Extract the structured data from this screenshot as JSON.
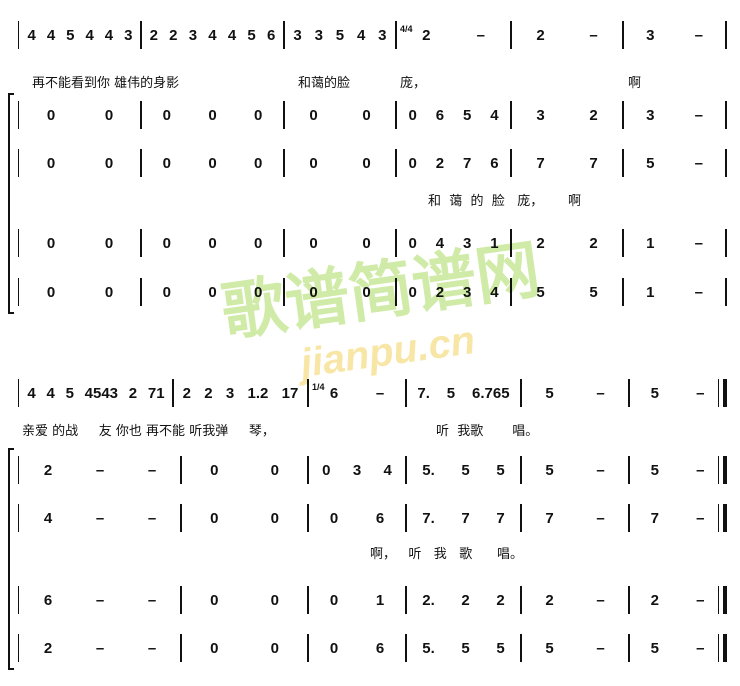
{
  "watermark": {
    "main": "歌谱简谱网",
    "sub": "jianpu.cn",
    "color": "#96d23c"
  },
  "systems": [
    {
      "time_signature": "4/4",
      "melody": [
        "4 4 5 4 4 3",
        "2 2 3 4 4 5 6",
        "3 3 5 4 3",
        "2 –",
        "2 –",
        "3 –"
      ],
      "melody_lyrics": [
        "再不能看到你 雄伟的身影",
        "和蔼的脸",
        "庞，",
        "啊"
      ],
      "parts": [
        [
          "0 0",
          "0 0 0",
          "0 0",
          "0 6 5 4",
          "3 2",
          "3 –"
        ],
        [
          "0 0",
          "0 0 0",
          "0 0",
          "0 2 7 6",
          "7 7",
          "5 –"
        ],
        [
          "0 0",
          "0 0 0",
          "0 0",
          "0 4 3 1",
          "2 2",
          "1 –"
        ],
        [
          "0 0",
          "0 0 0",
          "0 0",
          "0 2 3 4",
          "5 5",
          "1 –"
        ]
      ],
      "part_lyrics": "和  蔼  的  脸   庞，      啊"
    },
    {
      "time_signature": "1/4",
      "melody": [
        "4 4 5 4543 2 71",
        "2 2 3 1.2 17",
        "6 –",
        "7. 5 6.765",
        "5 –",
        "5 –"
      ],
      "melody_lyrics": [
        "亲爱 的战     友 你也 再不能 听我弹     琴，",
        "听  我歌       唱。"
      ],
      "parts": [
        [
          "2 – –",
          "0 0",
          "0 3 4",
          "5. 5 5",
          "5 –",
          "5 –"
        ],
        [
          "4 – –",
          "0 0",
          "0 6",
          "7. 7 7",
          "7 –",
          "7 –"
        ],
        [
          "6 – –",
          "0 0",
          "0 1",
          "2. 2 2",
          "2 –",
          "2 –"
        ],
        [
          "2 – –",
          "0 0",
          "0 6",
          "5. 5 5",
          "5 –",
          "5 –"
        ]
      ],
      "part_lyrics": "啊，   听   我   歌      唱。"
    }
  ]
}
